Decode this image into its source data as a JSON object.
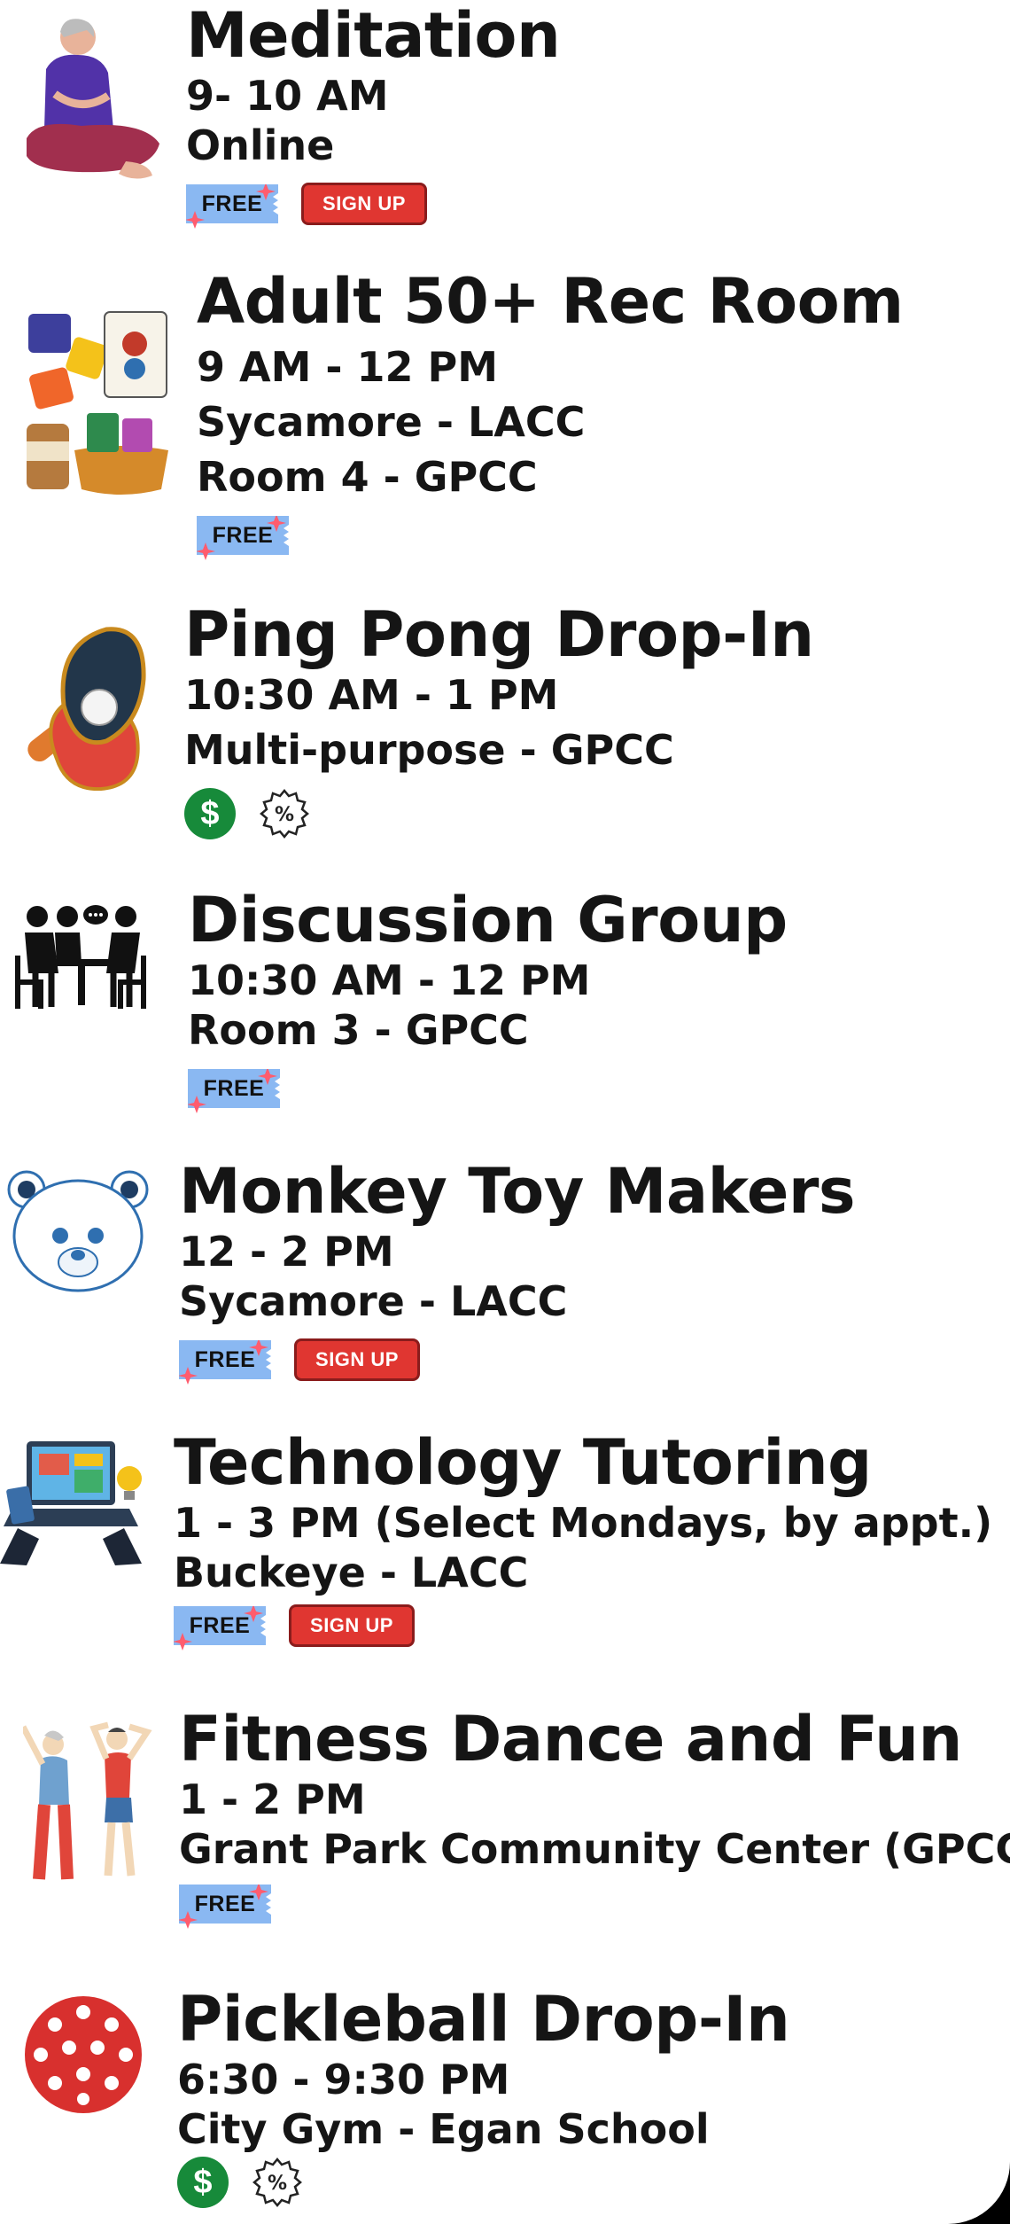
{
  "badges": {
    "free": "FREE",
    "sign_up": "SIGN UP",
    "fee_symbol": "$",
    "discount_symbol": "%",
    "free_color": "#8ab8f2",
    "sparkle_color": "#ff5c6e",
    "sign_up_color": "#e03631",
    "fee_color": "#178a3a"
  },
  "events": [
    {
      "icon": "meditation-icon",
      "title": "Meditation",
      "lines": [
        "9- 10 AM",
        "Online"
      ],
      "badges": [
        "free",
        "sign-up"
      ]
    },
    {
      "icon": "games-icon",
      "title": "Adult 50+ Rec Room",
      "lines": [
        "9 AM - 12 PM",
        "Sycamore - LACC",
        "Room 4 - GPCC"
      ],
      "badges": [
        "free"
      ]
    },
    {
      "icon": "ping-pong-icon",
      "title": "Ping Pong Drop-In",
      "lines": [
        "10:30 AM - 1 PM",
        "Multi-purpose - GPCC"
      ],
      "badges": [
        "fee",
        "discount"
      ]
    },
    {
      "icon": "discussion-icon",
      "title": "Discussion Group",
      "lines": [
        "10:30 AM - 12 PM",
        "Room 3 - GPCC"
      ],
      "badges": [
        "free"
      ]
    },
    {
      "icon": "bear-icon",
      "title": "Monkey Toy Makers",
      "lines": [
        "12 - 2 PM",
        "Sycamore - LACC"
      ],
      "badges": [
        "free",
        "sign-up"
      ]
    },
    {
      "icon": "laptop-icon",
      "title": "Technology Tutoring",
      "lines": [
        "1 - 3 PM (Select Mondays, by appt.)",
        "Buckeye - LACC"
      ],
      "badges": [
        "free",
        "sign-up"
      ]
    },
    {
      "icon": "dance-icon",
      "title": "Fitness Dance and Fun",
      "lines": [
        "1 - 2 PM",
        "Grant Park Community Center (GPCC)"
      ],
      "badges": [
        "free"
      ]
    },
    {
      "icon": "pickleball-icon",
      "title": "Pickleball Drop-In",
      "lines": [
        "6:30 - 9:30 PM",
        "City Gym - Egan School"
      ],
      "badges": [
        "fee",
        "discount"
      ]
    }
  ]
}
